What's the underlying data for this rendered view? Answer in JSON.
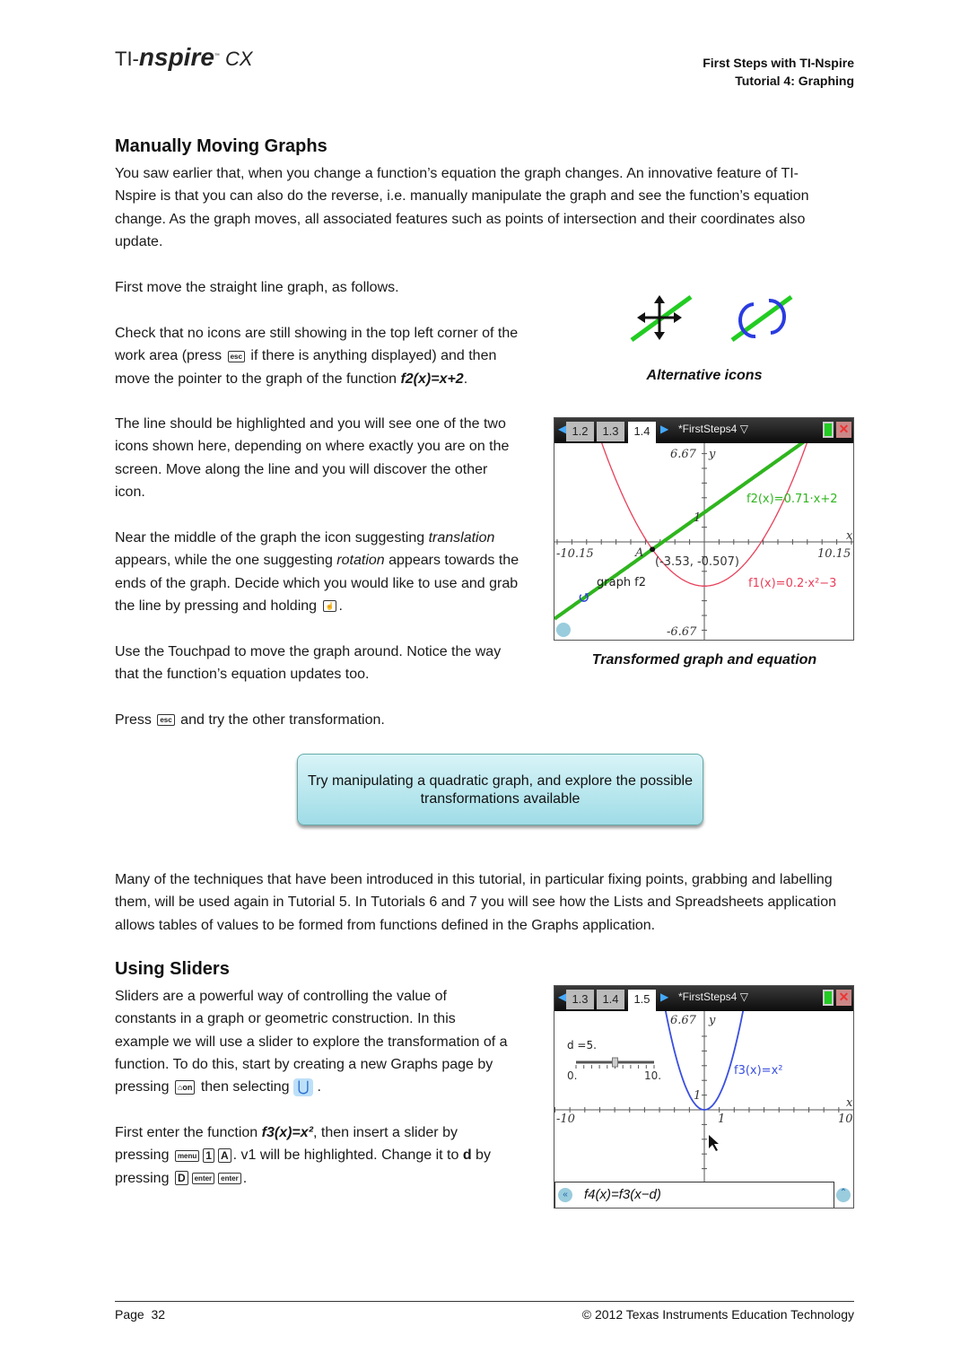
{
  "header": {
    "logo": "TI-nspire CX",
    "title_line1": "First Steps with TI-Nspire",
    "title_line2": "Tutorial 4: Graphing"
  },
  "section1": {
    "heading": "Manually Moving Graphs",
    "intro": "You saw earlier that, when you change a function’s equation the graph changes. An innovative feature of TI-Nspire is that you can also do the reverse, i.e. manually manipulate the graph and see the function’s equation change. As the graph moves, all associated features such as points of intersection and their coordinates also update.",
    "p2": "First move the straight line graph, as follows.",
    "p3a": "Check that no icons are still showing in the top left corner of the work area (press",
    "p3_key": "esc",
    "p3b": "if there is anything displayed) and then move the pointer to the graph of the function",
    "p3_fn": "f2(x)=x+2",
    "p3c": ".",
    "p4": "The line should be highlighted and you will see one of the two icons shown here, depending on where exactly you are on the screen. Move along the line and you will discover the other icon.",
    "p5a": "Near the middle of the graph the icon suggesting",
    "p5_t": "translation",
    "p5b": "appears, while the one suggesting",
    "p5_r": "rotation",
    "p5c": "appears towards the ends of the graph. Decide which you would like to use and grab the line by pressing and holding",
    "p5d": ".",
    "p6": "Use the Touchpad to move the graph around. Notice the way that the function’s equation updates too.",
    "p7a": "Press",
    "p7_key": "esc",
    "p7b": "and try the other transformation.",
    "icons_caption": "Alternative icons",
    "graph_caption": "Transformed graph and equation",
    "callout": "Try manipulating a quadratic graph, and explore the possible transformations available",
    "p8": "Many of the techniques that have been introduced in this tutorial, in particular fixing points, grabbing and labelling them, will be used again in Tutorial 5. In Tutorials 6 and 7 you will see how the Lists and Spreadsheets application allows tables of values to be formed from functions defined in the Graphs application."
  },
  "screen1": {
    "tabs": [
      "1.2",
      "1.3",
      "1.4"
    ],
    "active_tab": "1.4",
    "doc": "*FirstSteps4",
    "ymax": "6.67",
    "ymin": "-6.67",
    "xmin": "-10.15",
    "xmax": "10.15",
    "xlabel": "x",
    "ylabel": "y",
    "one": "1",
    "f2_label": "f2(x)=0.71·x+2",
    "f1_label": "f1(x)=0.2·x²−3",
    "point_label": "A",
    "point_coords": "(-3.53, -0.507)",
    "graph_label": "graph f2",
    "colors": {
      "f1": "#e8405a",
      "f2": "#2fb51e"
    }
  },
  "section2": {
    "heading": "Using Sliders",
    "p1a": "Sliders are a powerful way of controlling the value of constants in a graph or geometric construction.  In this example we will use a slider to explore the transformation of a function.  To do this, start by creating a new Graphs page by pressing",
    "p1_key": "⌂on",
    "p1b": "then selecting",
    "p1c": ".",
    "p2a": "First enter the function",
    "p2_fn": "f3(x)=x²",
    "p2b": ", then insert a slider by pressing",
    "keys1": [
      "menu",
      "1",
      "A"
    ],
    "p2c": ".  v1 will be highlighted. Change it to",
    "p2_d": "d",
    "p2d": "by pressing",
    "keys2": [
      "D",
      "enter",
      "enter"
    ],
    "p2e": "."
  },
  "screen2": {
    "tabs": [
      "1.3",
      "1.4",
      "1.5"
    ],
    "active_tab": "1.5",
    "doc": "*FirstSteps4",
    "ymax": "6.67",
    "xmin": "-10",
    "xmax": "10",
    "xlabel": "x",
    "ylabel": "y",
    "one": "1",
    "slider_label": "d =5.",
    "slider_min": "0.",
    "slider_max": "10.",
    "slider_value": 5,
    "f3_label": "f3(x)=x²",
    "entry": "f4(x)=f3(x−d)",
    "colors": {
      "f3": "#3a4fe0"
    }
  },
  "footer": {
    "page": "Page  32",
    "copyright": "© 2012 Texas Instruments Education Technology"
  }
}
